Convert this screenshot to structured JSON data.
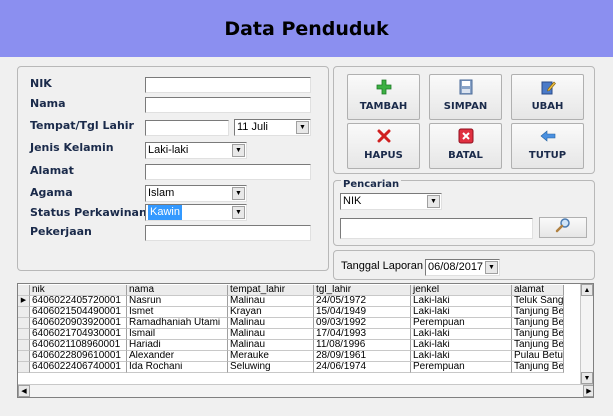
{
  "title": "Data Penduduk",
  "form": {
    "nik_label": "NIK",
    "nama_label": "Nama",
    "ttl_label": "Tempat/Tgl Lahir",
    "jenkel_label": "Jenis Kelamin",
    "alamat_label": "Alamat",
    "agama_label": "Agama",
    "status_label": "Status Perkawinan",
    "pekerjaan_label": "Pekerjaan",
    "nik_value": "",
    "nama_value": "",
    "tempat_value": "",
    "tgl_value": "11     Juli",
    "jenkel_value": "Laki-laki",
    "alamat_value": "",
    "agama_value": "Islam",
    "status_value": "Kawin",
    "pekerjaan_value": ""
  },
  "buttons": {
    "tambah": "TAMBAH",
    "simpan": "SIMPAN",
    "ubah": "UBAH",
    "hapus": "HAPUS",
    "batal": "BATAL",
    "tutup": "TUTUP"
  },
  "search": {
    "title": "Pencarian",
    "field_value": "NIK",
    "query": ""
  },
  "report": {
    "label": "Tanggal Laporan",
    "date": "06/08/2017"
  },
  "grid": {
    "columns": [
      "nik",
      "nama",
      "tempat_lahir",
      "tgl_lahir",
      "jenkel",
      "alamat"
    ],
    "rows": [
      [
        "6406022405720001",
        "Nasrun",
        "Malinau",
        "24/05/1972",
        "Laki-laki",
        "Teluk Sang"
      ],
      [
        "6406021504490001",
        "Ismet",
        "Krayan",
        "15/04/1949",
        "Laki-laki",
        "Tanjung Be"
      ],
      [
        "6406020903920001",
        "Ramadhaniah Utami",
        "Malinau",
        "09/03/1992",
        "Perempuan",
        "Tanjung Be"
      ],
      [
        "6406021704930001",
        "Ismail",
        "Malinau",
        "17/04/1993",
        "Laki-laki",
        "Tanjung Be"
      ],
      [
        "6406021108960001",
        "Hariadi",
        "Malinau",
        "11/08/1996",
        "Laki-laki",
        "Tanjung Be"
      ],
      [
        "6406022809610001",
        "Alexander",
        "Merauke",
        "28/09/1961",
        "Laki-laki",
        "Pulau Betu"
      ],
      [
        "6406022406740001",
        "Ida Rochani",
        "Seluwing",
        "24/06/1974",
        "Perempuan",
        "Tanjung Be"
      ]
    ]
  }
}
